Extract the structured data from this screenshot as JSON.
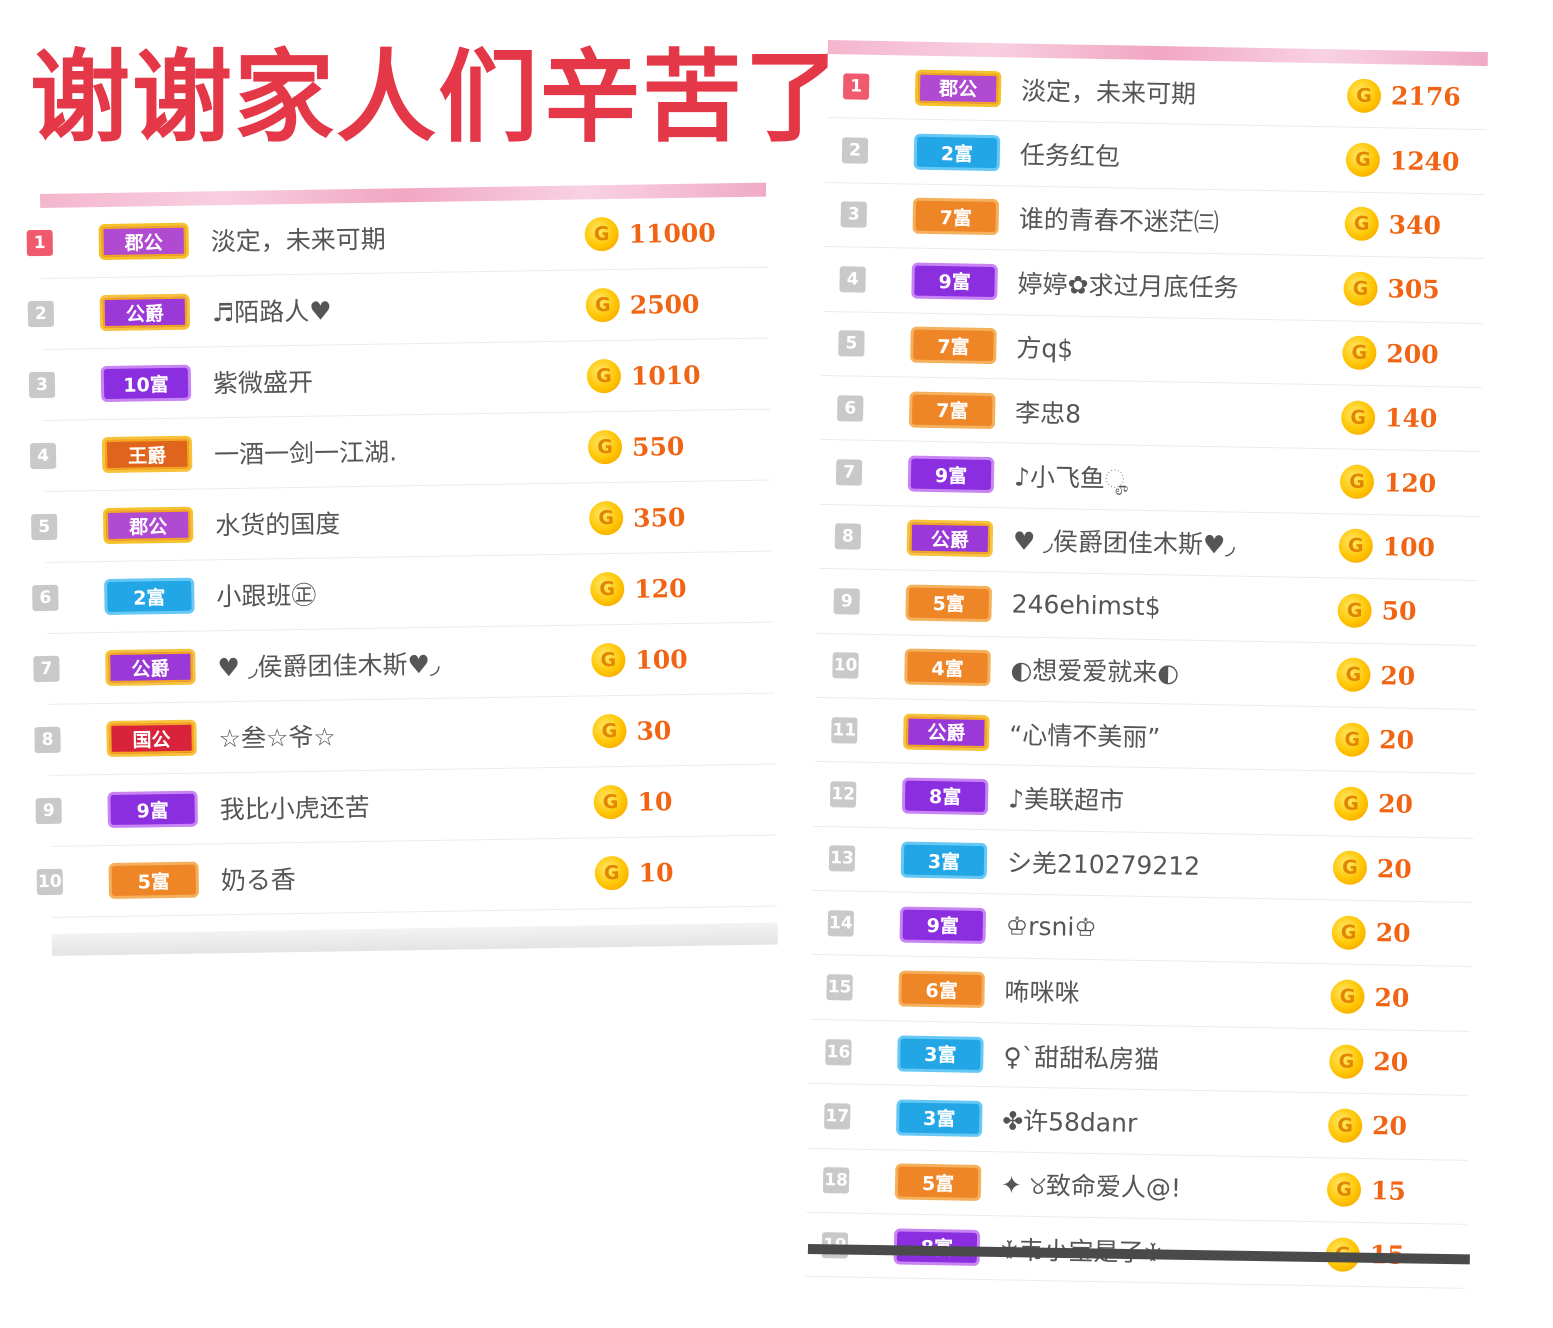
{
  "headline": "谢谢家人们辛苦了",
  "coin_glyph": "G",
  "left_board": {
    "rows": [
      {
        "rank": "1",
        "badge": "郡公",
        "badge_style": "b-duke",
        "name": "淡定，未来可期",
        "amount": "11000"
      },
      {
        "rank": "2",
        "badge": "公爵",
        "badge_style": "b-marquis",
        "name": "♬陌路人♥",
        "amount": "2500"
      },
      {
        "rank": "3",
        "badge": "10富",
        "badge_style": "b-purple",
        "name": "紫微盛开",
        "amount": "1010"
      },
      {
        "rank": "4",
        "badge": "王爵",
        "badge_style": "b-king",
        "name": "一酒一剑一江湖.",
        "amount": "550"
      },
      {
        "rank": "5",
        "badge": "郡公",
        "badge_style": "b-duke",
        "name": "水货的国度",
        "amount": "350"
      },
      {
        "rank": "6",
        "badge": "2富",
        "badge_style": "b-blue",
        "name": "小跟班㊣",
        "amount": "120"
      },
      {
        "rank": "7",
        "badge": "公爵",
        "badge_style": "b-marquis",
        "name": "♥ ◞侯爵团佳木斯♥◞",
        "amount": "100"
      },
      {
        "rank": "8",
        "badge": "国公",
        "badge_style": "b-nation",
        "name": "☆叁☆爷☆",
        "amount": "30"
      },
      {
        "rank": "9",
        "badge": "9富",
        "badge_style": "b-purple",
        "name": "我比小虎还苦",
        "amount": "10"
      },
      {
        "rank": "10",
        "badge": "5富",
        "badge_style": "b-orange",
        "name": "奶る香",
        "amount": "10"
      }
    ]
  },
  "right_board": {
    "rows": [
      {
        "rank": "1",
        "badge": "郡公",
        "badge_style": "b-duke",
        "name": "淡定，未来可期",
        "amount": "2176"
      },
      {
        "rank": "2",
        "badge": "2富",
        "badge_style": "b-blue",
        "name": "任务红包",
        "amount": "1240"
      },
      {
        "rank": "3",
        "badge": "7富",
        "badge_style": "b-orange",
        "name": "谁的青春不迷茫㈢",
        "amount": "340"
      },
      {
        "rank": "4",
        "badge": "9富",
        "badge_style": "b-purple",
        "name": "婷婷✿求过月底任务",
        "amount": "305"
      },
      {
        "rank": "5",
        "badge": "7富",
        "badge_style": "b-orange",
        "name": "方q$",
        "amount": "200"
      },
      {
        "rank": "6",
        "badge": "7富",
        "badge_style": "b-orange",
        "name": "李忠8",
        "amount": "140"
      },
      {
        "rank": "7",
        "badge": "9富",
        "badge_style": "b-purple",
        "name": "♪小飞鱼ೄ",
        "amount": "120"
      },
      {
        "rank": "8",
        "badge": "公爵",
        "badge_style": "b-marquis",
        "name": "♥ ◞侯爵团佳木斯♥◞",
        "amount": "100"
      },
      {
        "rank": "9",
        "badge": "5富",
        "badge_style": "b-orange",
        "name": "246ehimst$",
        "amount": "50"
      },
      {
        "rank": "10",
        "badge": "4富",
        "badge_style": "b-orange",
        "name": "◐想爱爱就来◐",
        "amount": "20"
      },
      {
        "rank": "11",
        "badge": "公爵",
        "badge_style": "b-marquis",
        "name": "“心情不美丽”",
        "amount": "20"
      },
      {
        "rank": "12",
        "badge": "8富",
        "badge_style": "b-purple",
        "name": "♪美联超市",
        "amount": "20"
      },
      {
        "rank": "13",
        "badge": "3富",
        "badge_style": "b-blue",
        "name": "シ羌210279212",
        "amount": "20"
      },
      {
        "rank": "14",
        "badge": "9富",
        "badge_style": "b-purple",
        "name": "♔rsni♔",
        "amount": "20"
      },
      {
        "rank": "15",
        "badge": "6富",
        "badge_style": "b-orange",
        "name": "咘咪咪",
        "amount": "20"
      },
      {
        "rank": "16",
        "badge": "3富",
        "badge_style": "b-blue",
        "name": "♀`甜甜私房猫",
        "amount": "20"
      },
      {
        "rank": "17",
        "badge": "3富",
        "badge_style": "b-blue",
        "name": "✤许58danr",
        "amount": "20"
      },
      {
        "rank": "18",
        "badge": "5富",
        "badge_style": "b-orange",
        "name": "✦ ୪致命爱人@!",
        "amount": "15"
      },
      {
        "rank": "19",
        "badge": "8富",
        "badge_style": "b-purple",
        "name": "♰韦小宝是了♰",
        "amount": "15"
      }
    ]
  }
}
